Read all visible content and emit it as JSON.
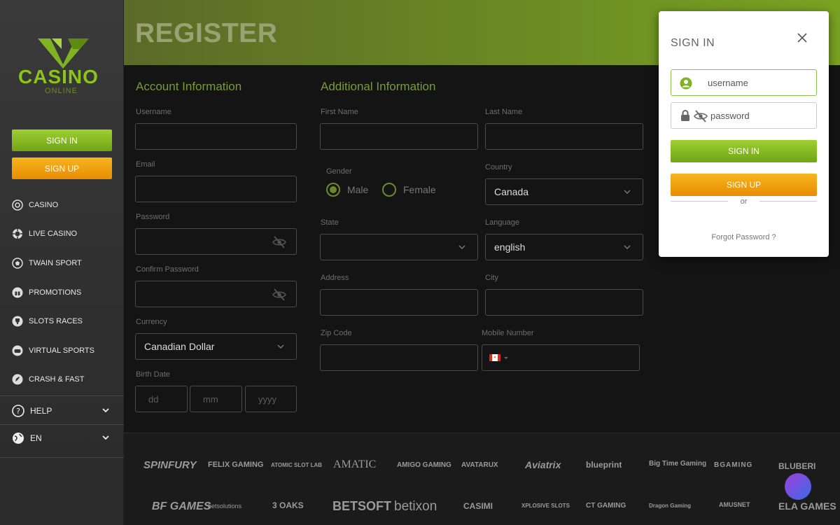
{
  "brand": {
    "name": "CASINO",
    "sub": "ONLINE"
  },
  "sidebar": {
    "sign_in": "SIGN IN",
    "sign_up": "SIGN UP",
    "items": [
      {
        "label": "CASINO",
        "icon": "roulette-icon"
      },
      {
        "label": "LIVE CASINO",
        "icon": "chip-icon"
      },
      {
        "label": "TWAIN SPORT",
        "icon": "ball-icon"
      },
      {
        "label": "PROMOTIONS",
        "icon": "gift-icon"
      },
      {
        "label": "SLOTS RACES",
        "icon": "trophy-icon"
      },
      {
        "label": "VIRTUAL SPORTS",
        "icon": "gamepad-icon"
      },
      {
        "label": "CRASH & FAST",
        "icon": "rocket-icon"
      }
    ],
    "help": "HELP",
    "language": "EN"
  },
  "header": {
    "title": "REGISTER"
  },
  "form": {
    "account_title": "Account Information",
    "additional_title": "Additional Information",
    "username_label": "Username",
    "email_label": "Email",
    "password_label": "Password",
    "confirm_password_label": "Confirm Password",
    "currency_label": "Currency",
    "currency_value": "Canadian Dollar",
    "birth_label": "Birth Date",
    "birth_dd": "dd",
    "birth_mm": "mm",
    "birth_yyyy": "yyyy",
    "first_name_label": "First Name",
    "last_name_label": "Last Name",
    "gender_label": "Gender",
    "gender_male": "Male",
    "gender_female": "Female",
    "country_label": "Country",
    "country_value": "Canada",
    "state_label": "State",
    "language_label": "Language",
    "language_value": "english",
    "address_label": "Address",
    "city_label": "City",
    "zip_label": "Zip Code",
    "mobile_label": "Mobile Number"
  },
  "providers": [
    "SPINFURY",
    "FELIX GAMING",
    "ATOMIC SLOT LAB",
    "AMATIC",
    "AMIGO GAMING",
    "AVATARUX",
    "Aviatrix",
    "blueprint",
    "Big Time Gaming",
    "BGAMING",
    "BLUBERI",
    "BF GAMES",
    "betsolutions",
    "3 OAKS",
    "BETSOFT",
    "betixon",
    "CASIMI",
    "XPLOSIVE SLOTS",
    "CT GAMING",
    "Dragon Gaming",
    "AMUSNET",
    "ELA GAMES"
  ],
  "modal": {
    "title": "SIGN IN",
    "username_placeholder": "username",
    "password_placeholder": "password",
    "sign_in": "SIGN IN",
    "sign_up": "SIGN UP",
    "or": "or",
    "forgot": "Forgot Password ?"
  },
  "colors": {
    "accent_green": "#7aa222",
    "accent_orange": "#f0a010"
  }
}
